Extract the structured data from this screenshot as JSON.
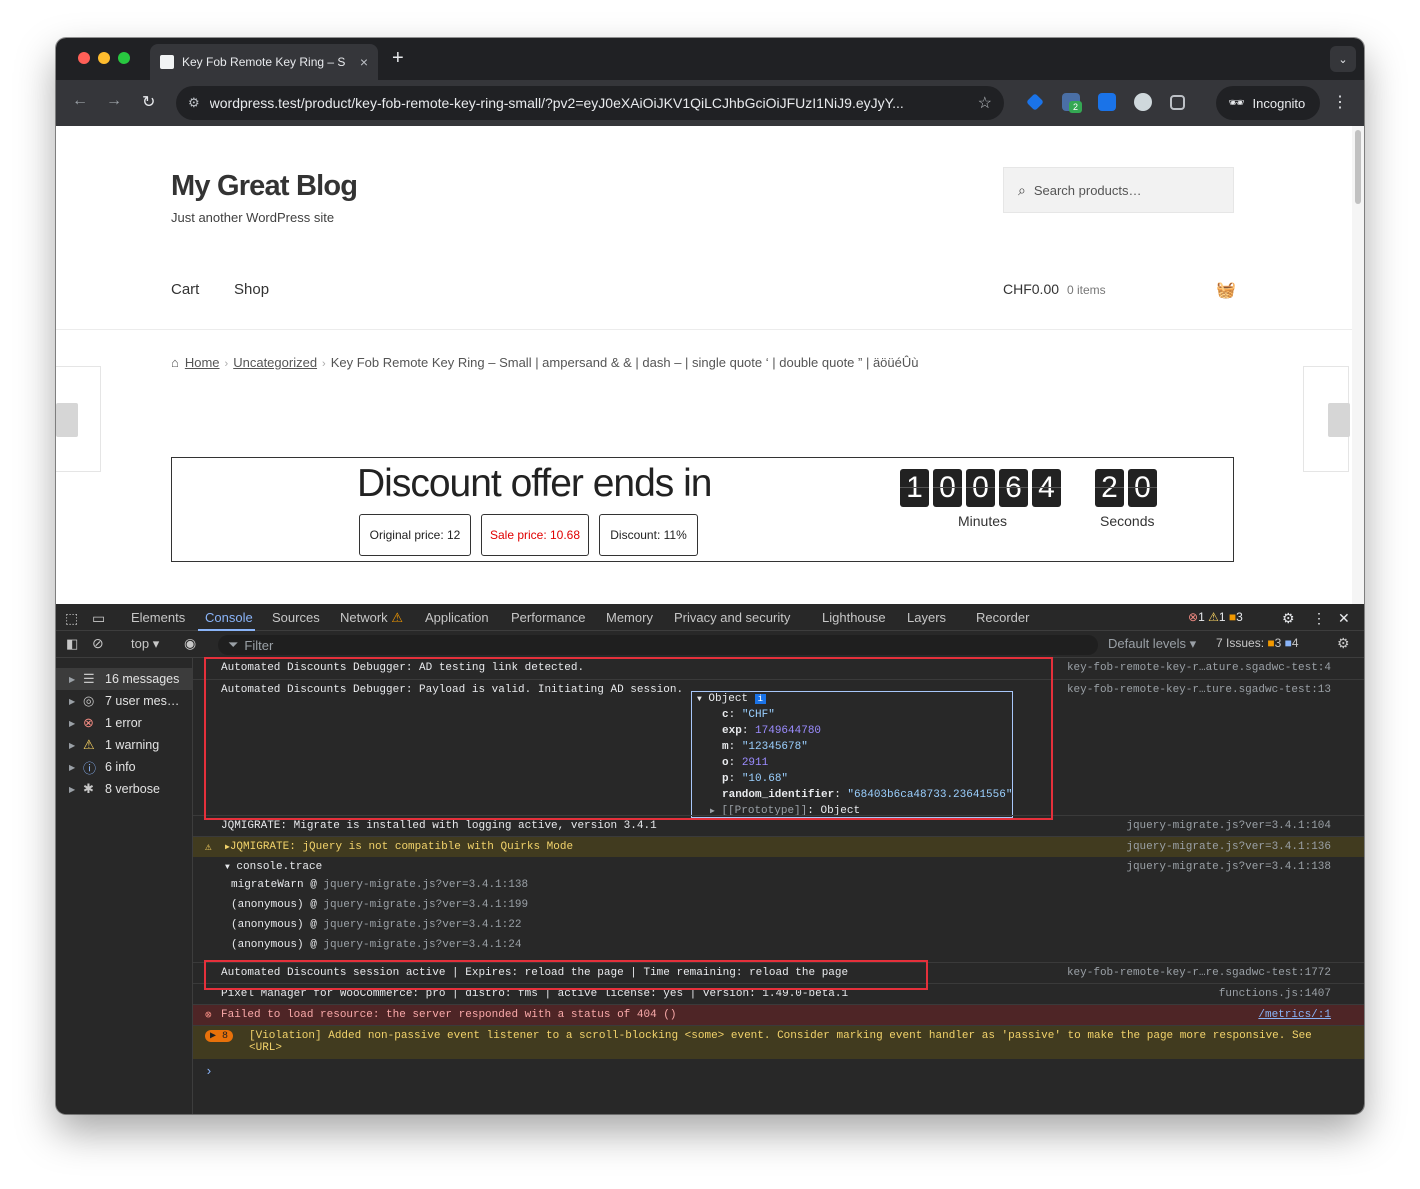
{
  "browser": {
    "tab_title": "Key Fob Remote Key Ring – S",
    "tab_close": "×",
    "new_tab": "+",
    "tab_menu": "⌄",
    "url": "wordpress.test/product/key-fob-remote-key-ring-small/?pv2=eyJ0eXAiOiJKV1QiLCJhbGciOiJFUzI1NiJ9.eyJyY...",
    "incognito_label": "Incognito",
    "extension_badge": "2",
    "nav": {
      "back": "←",
      "forward": "→",
      "reload": "↻",
      "star": "☆",
      "kebab": "⋮"
    }
  },
  "site": {
    "title": "My Great Blog",
    "tagline": "Just another WordPress site",
    "search_placeholder": "Search products…",
    "nav": [
      "Cart",
      "Shop"
    ],
    "cart_total": "CHF0.00",
    "cart_count": "0 items"
  },
  "breadcrumb": {
    "home": "Home",
    "category": "Uncategorized",
    "current": "Key Fob Remote Key Ring – Small | ampersand & & | dash – | single quote ‘ | double quote ” | äöüéÛù"
  },
  "discount": {
    "heading": "Discount offer ends in",
    "original": "Original price: 12",
    "sale": "Sale price: 10.68",
    "discount": "Discount: 11%",
    "minutes_digits": [
      "1",
      "0",
      "0",
      "6",
      "4"
    ],
    "seconds_digits": [
      "2",
      "0"
    ],
    "minutes_label": "Minutes",
    "seconds_label": "Seconds",
    "sale_color": "#e00000"
  },
  "devtools": {
    "tabs": [
      "Elements",
      "Console",
      "Sources",
      "Network",
      "Application",
      "Performance",
      "Memory",
      "Privacy and security",
      "Lighthouse",
      "Layers",
      "Recorder"
    ],
    "counts": {
      "errors": "1",
      "warnings": "1",
      "issues": "3"
    },
    "context": "top",
    "filter_placeholder": "Filter",
    "levels": "Default levels",
    "issues_label": "7 Issues:",
    "issues_a": "3",
    "issues_b": "4",
    "sidebar": [
      {
        "label": "16 messages",
        "icon": "list-icon"
      },
      {
        "label": "7 user mes…",
        "icon": "user-icon"
      },
      {
        "label": "1 error",
        "icon": "error-icon"
      },
      {
        "label": "1 warning",
        "icon": "warning-icon"
      },
      {
        "label": "6 info",
        "icon": "info-icon"
      },
      {
        "label": "8 verbose",
        "icon": "bug-icon"
      }
    ],
    "console": {
      "ad_detected": "Automated Discounts Debugger: AD testing link detected.",
      "ad_detected_src": "key-fob-remote-key-r…ature.sgadwc-test:4",
      "ad_valid": "Automated Discounts Debugger: Payload is valid. Initiating AD session.",
      "ad_valid_src": "key-fob-remote-key-r…ture.sgadwc-test:13",
      "object": {
        "header": "Object",
        "info_badge": "i",
        "c": "\"CHF\"",
        "exp": "1749644780",
        "m": "\"12345678\"",
        "o": "2911",
        "p": "\"10.68\"",
        "random_identifier": "\"68403b6ca48733.23641556\"",
        "prototype": "[[Prototype]]",
        "prototype_value": "Object"
      },
      "jqmigrate": "JQMIGRATE: Migrate is installed with logging active, version 3.4.1",
      "jqmigrate_src": "jquery-migrate.js?ver=3.4.1:104",
      "quirks": "JQMIGRATE: jQuery is not compatible with Quirks Mode",
      "quirks_src": "jquery-migrate.js?ver=3.4.1:136",
      "trace": "console.trace",
      "trace_src": "jquery-migrate.js?ver=3.4.1:138",
      "trace_lines": [
        {
          "fn": "migrateWarn @ ",
          "loc": "jquery-migrate.js?ver=3.4.1:138"
        },
        {
          "fn": "(anonymous) @ ",
          "loc": "jquery-migrate.js?ver=3.4.1:199"
        },
        {
          "fn": "(anonymous) @ ",
          "loc": "jquery-migrate.js?ver=3.4.1:22"
        },
        {
          "fn": "(anonymous) @ ",
          "loc": "jquery-migrate.js?ver=3.4.1:24"
        }
      ],
      "session": "Automated Discounts session active | Expires: reload the page | Time remaining: reload the page",
      "session_src": "key-fob-remote-key-r…re.sgadwc-test:1772",
      "pixel": "Pixel Manager for WooCommerce: pro | distro: fms | active license: yes | version: 1.49.0-beta.1",
      "pixel_src": "functions.js:1407",
      "failed": "Failed to load resource: the server responded with a status of 404 ()",
      "failed_src": "/metrics/:1",
      "violation_count": "8",
      "violation": "[Violation] Added non-passive event listener to a scroll-blocking <some> event. Consider marking event handler as 'passive' to make the page more responsive. See\n<URL>",
      "prompt": "›"
    }
  }
}
